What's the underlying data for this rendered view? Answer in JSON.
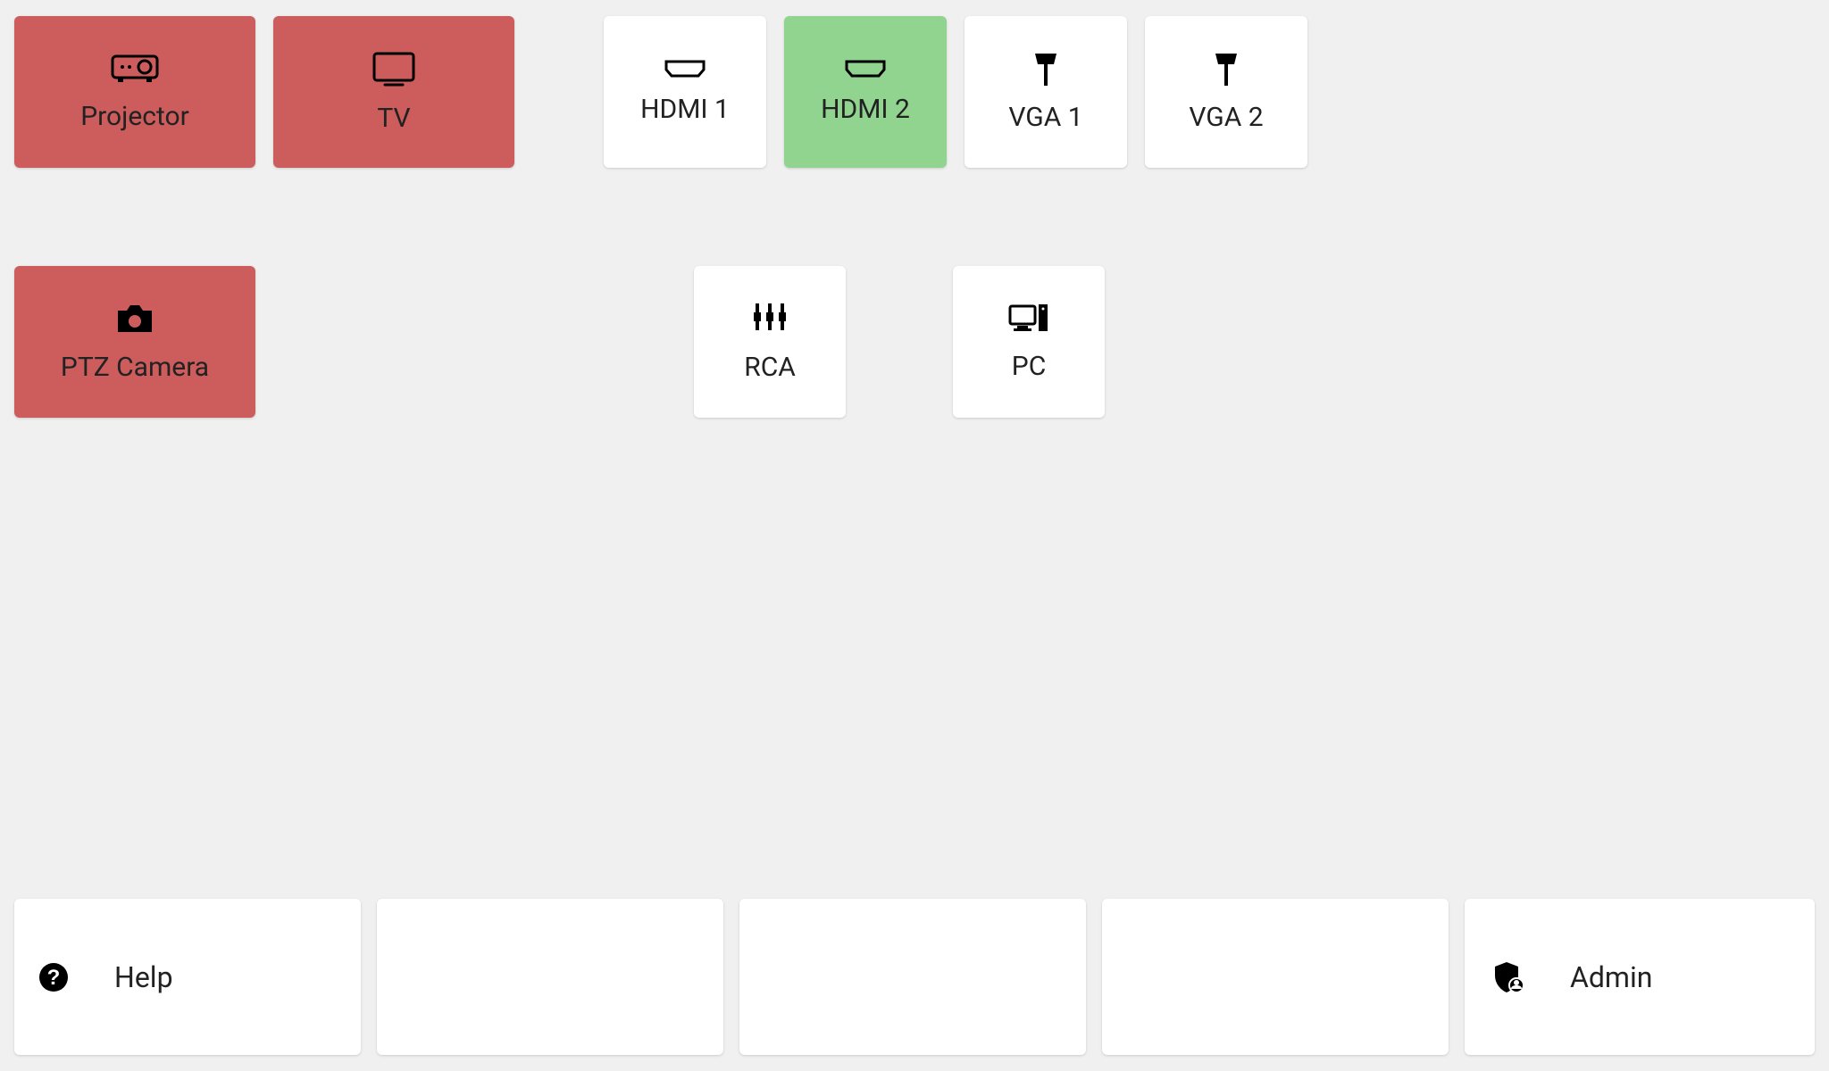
{
  "displays": {
    "row1": [
      {
        "id": "projector",
        "label": "Projector",
        "state": "off"
      },
      {
        "id": "tv",
        "label": "TV",
        "state": "off"
      }
    ],
    "row2": [
      {
        "id": "ptz-camera",
        "label": "PTZ Camera",
        "state": "off"
      }
    ]
  },
  "sources": {
    "row1": [
      {
        "id": "hdmi1",
        "label": "HDMI 1",
        "state": "idle"
      },
      {
        "id": "hdmi2",
        "label": "HDMI 2",
        "state": "active"
      },
      {
        "id": "vga1",
        "label": "VGA 1",
        "state": "idle"
      },
      {
        "id": "vga2",
        "label": "VGA 2",
        "state": "idle"
      }
    ],
    "row2": [
      {
        "id": "rca",
        "label": "RCA",
        "state": "idle"
      },
      {
        "id": "pc",
        "label": "PC",
        "state": "idle"
      }
    ]
  },
  "bottom": {
    "help": "Help",
    "admin": "Admin"
  },
  "colors": {
    "red": "#cd5c5c",
    "green": "#90d490",
    "white": "#ffffff",
    "bg": "#f0f0f0"
  }
}
